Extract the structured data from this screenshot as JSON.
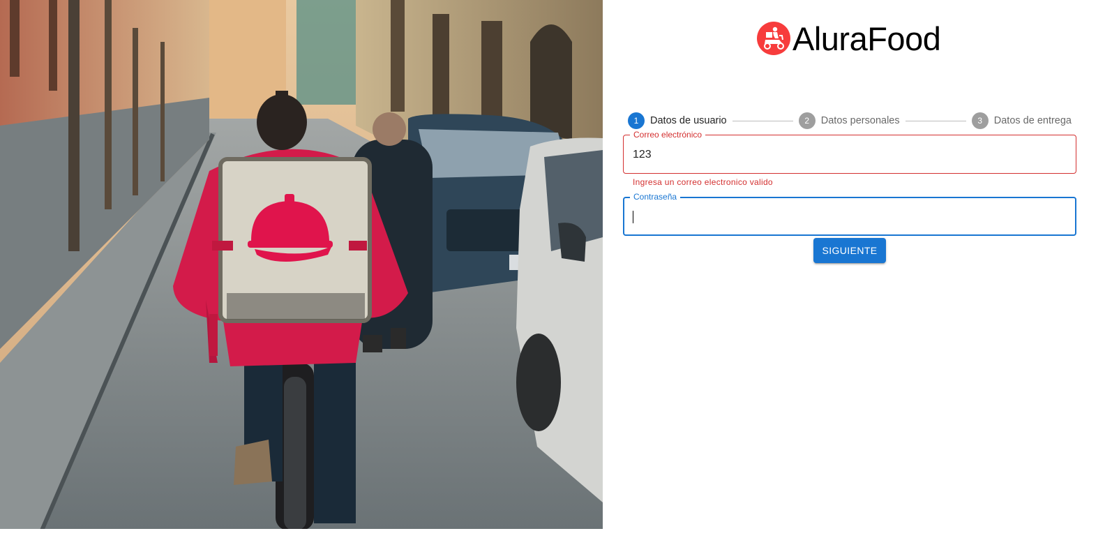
{
  "brand": {
    "name": "AluraFood",
    "logo_icon": "delivery-scooter-icon",
    "logo_color": "#f73c3c"
  },
  "stepper": {
    "steps": [
      {
        "number": "1",
        "label": "Datos de usuario",
        "state": "active"
      },
      {
        "number": "2",
        "label": "Datos personales",
        "state": "inactive"
      },
      {
        "number": "3",
        "label": "Datos de entrega",
        "state": "inactive"
      }
    ]
  },
  "form": {
    "email": {
      "label": "Correo electrónico",
      "value": "123",
      "helper_text": "Ingresa un correo electronico valido",
      "state": "error"
    },
    "password": {
      "label": "Contraseña",
      "value": "",
      "state": "focused"
    },
    "submit_label": "SIGUIENTE"
  },
  "colors": {
    "primary": "#1976d2",
    "error": "#d32f2f",
    "inactive_step": "#9e9e9e",
    "brand_red": "#f73c3c"
  },
  "hero_image": {
    "icons": [
      "cloche-icon"
    ]
  }
}
